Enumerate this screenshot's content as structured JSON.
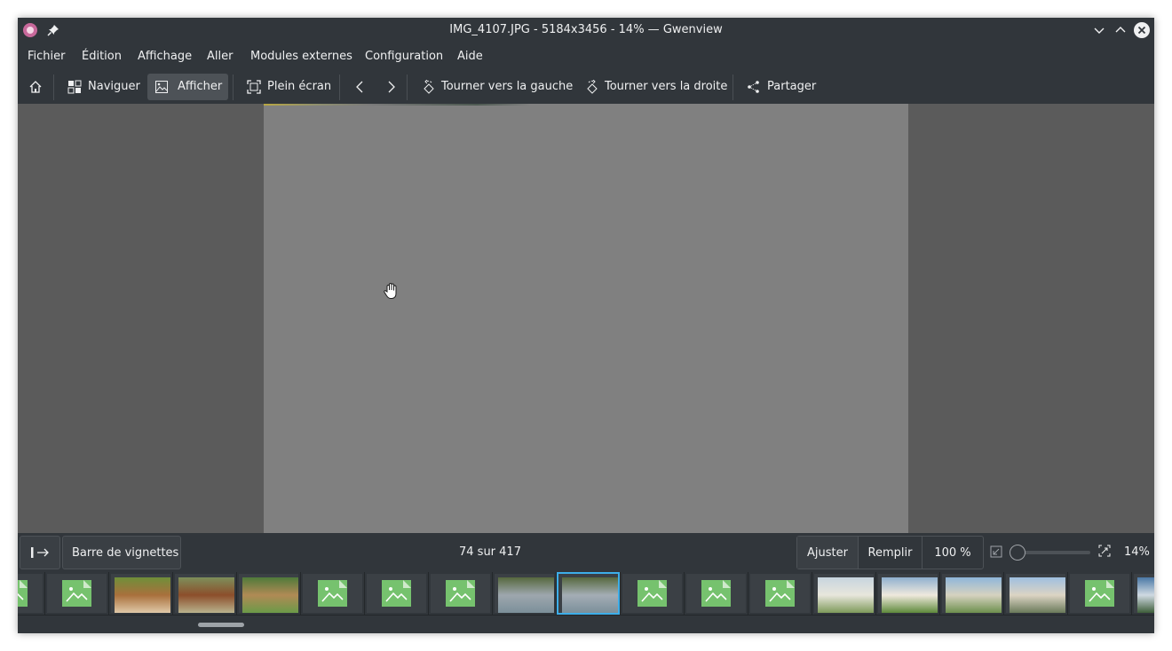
{
  "window": {
    "title": "IMG_4107.JPG - 5184x3456 - 14% — Gwenview",
    "icons": [
      "gwenview-app-icon",
      "pin-icon",
      "minimize-icon",
      "maximize-icon",
      "close-icon"
    ]
  },
  "menu": {
    "items": [
      "Fichier",
      "Édition",
      "Affichage",
      "Aller",
      "Modules externes",
      "Configuration",
      "Aide"
    ]
  },
  "toolbar": {
    "home_icon": "home-icon",
    "browse_label": "Naviguer",
    "view_label": "Afficher",
    "fullscreen_label": "Plein écran",
    "previous_icon": "chevron-left-icon",
    "next_icon": "chevron-right-icon",
    "rotate_left_label": "Tourner vers la gauche",
    "rotate_right_label": "Tourner vers la droite",
    "share_label": "Partager"
  },
  "viewer": {
    "cursor": "open-hand-icon"
  },
  "statusbar": {
    "sidebar_toggle_icon": "sidebar-toggle-icon",
    "thumbnail_bar_label": "Barre de vignettes",
    "position_text": "74 sur 417",
    "fit_label": "Ajuster",
    "fill_label": "Remplir",
    "actual_size_label": "100 %",
    "zoom_percent": "14%",
    "zoom_slider_value": 0.0
  },
  "thumbnails": {
    "items": [
      {
        "kind": "placeholder"
      },
      {
        "kind": "placeholder"
      },
      {
        "kind": "photo",
        "subject": "horse-portrait",
        "colors": [
          "#6f8f3a",
          "#a9703c",
          "#e0c9a8"
        ]
      },
      {
        "kind": "photo",
        "subject": "pony-field",
        "colors": [
          "#7d8f5a",
          "#8c4e2b",
          "#b9b38d"
        ]
      },
      {
        "kind": "photo",
        "subject": "wooden-sign",
        "colors": [
          "#4f7a3a",
          "#b08a55",
          "#6b9a48"
        ]
      },
      {
        "kind": "placeholder"
      },
      {
        "kind": "placeholder"
      },
      {
        "kind": "placeholder"
      },
      {
        "kind": "photo",
        "subject": "village-rooftops",
        "colors": [
          "#56683e",
          "#9ea7ae",
          "#7b8f9a"
        ]
      },
      {
        "kind": "photo",
        "subject": "village-rooftops",
        "colors": [
          "#56683e",
          "#a4adb5",
          "#7b8f9a"
        ],
        "selected": true
      },
      {
        "kind": "placeholder"
      },
      {
        "kind": "placeholder"
      },
      {
        "kind": "placeholder"
      },
      {
        "kind": "photo",
        "subject": "white-cliffs",
        "colors": [
          "#c7d5df",
          "#e8e6dc",
          "#7e9a5a"
        ]
      },
      {
        "kind": "photo",
        "subject": "cliff-path",
        "colors": [
          "#8fb0cf",
          "#efe9dd",
          "#5e8a3b"
        ]
      },
      {
        "kind": "photo",
        "subject": "people-beach",
        "colors": [
          "#8fb6da",
          "#d6d2c0",
          "#6d8f4d"
        ]
      },
      {
        "kind": "photo",
        "subject": "people-beach",
        "colors": [
          "#9fbfe0",
          "#dcd4c4",
          "#6a7a5a"
        ]
      },
      {
        "kind": "placeholder"
      },
      {
        "kind": "photo",
        "subject": "sea-view",
        "colors": [
          "#4a78a6",
          "#cfd9e2",
          "#3e5e3a"
        ]
      }
    ]
  }
}
